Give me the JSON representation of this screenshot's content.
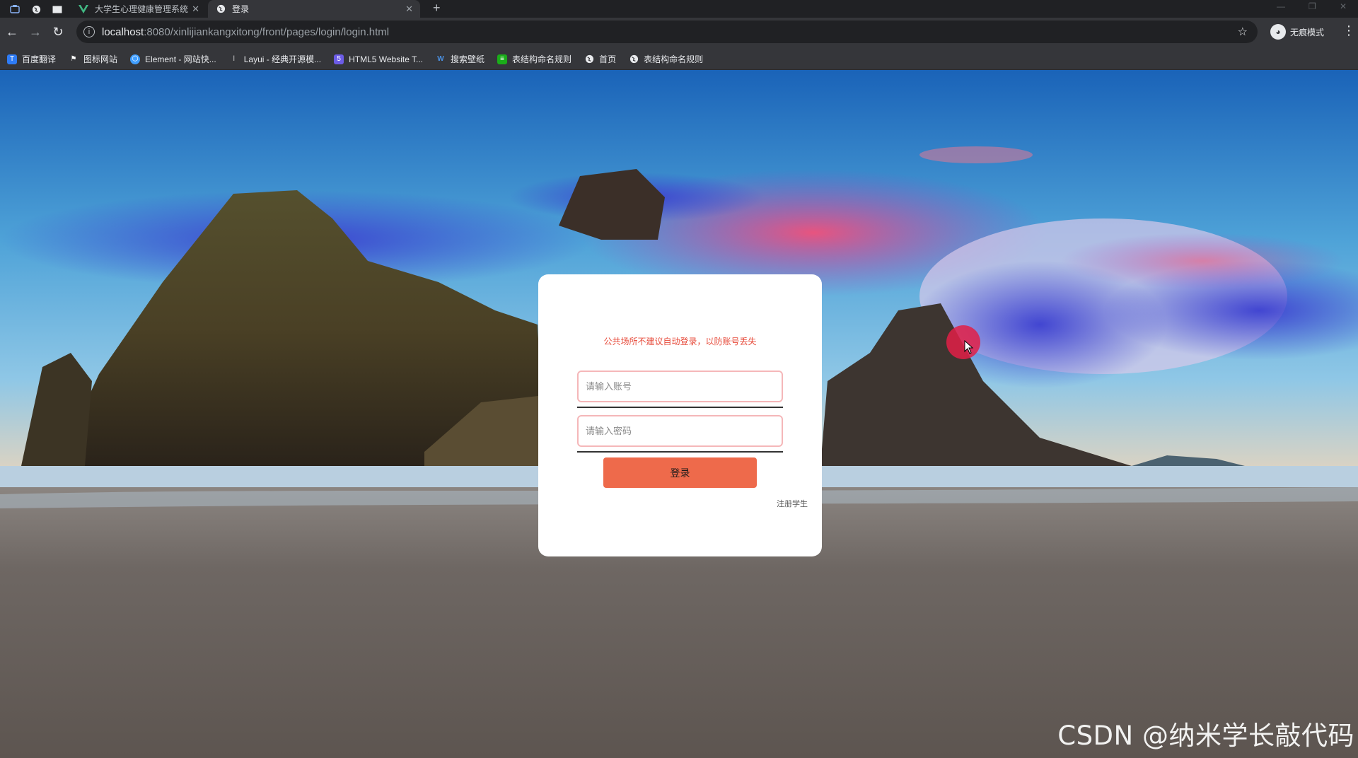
{
  "browser": {
    "tabs": [
      {
        "title": "大学生心理健康管理系统",
        "favicon": "vue-icon",
        "active": false
      },
      {
        "title": "登录",
        "favicon": "globe-icon",
        "active": true
      }
    ],
    "url_host": "localhost",
    "url_path": ":8080/xinlijiankangxitong/front/pages/login/login.html",
    "profile_label": "无痕模式",
    "bookmarks": [
      {
        "label": "百度翻译",
        "icon": "baidu-translate-icon",
        "color": "#2e7cf6"
      },
      {
        "label": "图标网站",
        "icon": "flag-icon",
        "color": "#ffffff"
      },
      {
        "label": "Element - 网站快...",
        "icon": "element-icon",
        "color": "#409eff"
      },
      {
        "label": "Layui - 经典开源模...",
        "icon": "layui-icon",
        "color": "#cccccc"
      },
      {
        "label": "HTML5 Website T...",
        "icon": "html5-icon",
        "color": "#6c5ce7"
      },
      {
        "label": "搜索壁纸",
        "icon": "wallpaper-icon",
        "color": "#4a90e2"
      },
      {
        "label": "表结构命名规则",
        "icon": "sheet-icon",
        "color": "#1aad19"
      },
      {
        "label": "首页",
        "icon": "globe-icon",
        "color": "#e8eaed"
      },
      {
        "label": "表结构命名规则",
        "icon": "globe-icon",
        "color": "#e8eaed"
      }
    ]
  },
  "login": {
    "warning": "公共场所不建议自动登录，以防账号丢失",
    "account_placeholder": "请输入账号",
    "password_placeholder": "请输入密码",
    "login_button": "登录",
    "register_link": "注册学生"
  },
  "watermark": "CSDN @纳米学长敲代码",
  "colors": {
    "login_button": "#ee6a4b",
    "warning_text": "#e74c3c",
    "input_border": "#f5b7b9"
  }
}
